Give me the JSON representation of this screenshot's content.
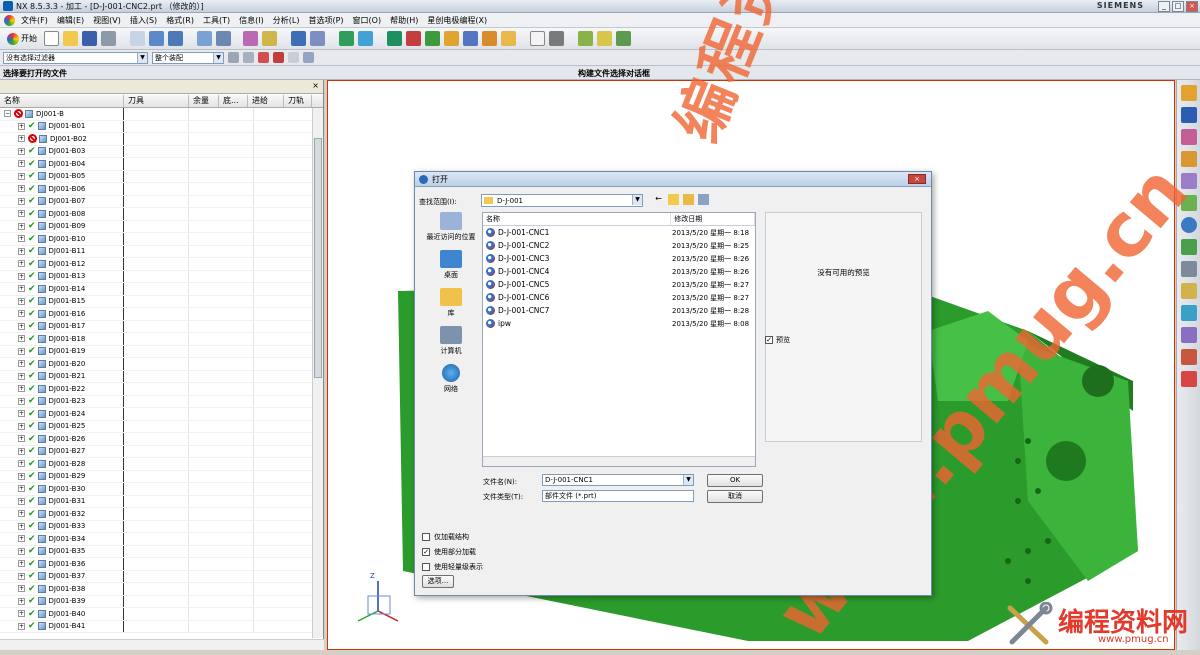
{
  "window": {
    "title": "NX 8.5.3.3 - 加工 - [D-J-001-CNC2.prt （修改的）]",
    "brand": "SIEMENS",
    "controls": [
      "_",
      "□",
      "×"
    ]
  },
  "menu": [
    "文件(F)",
    "编辑(E)",
    "视图(V)",
    "插入(S)",
    "格式(R)",
    "工具(T)",
    "信息(I)",
    "分析(L)",
    "首选项(P)",
    "窗口(O)",
    "帮助(H)",
    "星创电极编程(X)"
  ],
  "toolbar": {
    "start_label": "开始"
  },
  "filter_bar": {
    "filter_value": "没有选择过滤器",
    "assembly_value": "整个装配"
  },
  "prompt": {
    "left": "选择要打开的文件",
    "center": "构建文件选择对话框"
  },
  "navigator": {
    "columns": [
      "名称",
      "刀具",
      "余量",
      "底...",
      "进给",
      "刀轨"
    ],
    "root": "DJ001-B",
    "items": [
      "DJ001-B01",
      "DJ001-B02",
      "DJ001-B03",
      "DJ001-B04",
      "DJ001-B05",
      "DJ001-B06",
      "DJ001-B07",
      "DJ001-B08",
      "DJ001-B09",
      "DJ001-B10",
      "DJ001-B11",
      "DJ001-B12",
      "DJ001-B13",
      "DJ001-B14",
      "DJ001-B15",
      "DJ001-B16",
      "DJ001-B17",
      "DJ001-B18",
      "DJ001-B19",
      "DJ001-B20",
      "DJ001-B21",
      "DJ001-B22",
      "DJ001-B23",
      "DJ001-B24",
      "DJ001-B25",
      "DJ001-B26",
      "DJ001-B27",
      "DJ001-B28",
      "DJ001-B29",
      "DJ001-B30",
      "DJ001-B31",
      "DJ001-B32",
      "DJ001-B33",
      "DJ001-B34",
      "DJ001-B35",
      "DJ001-B36",
      "DJ001-B37",
      "DJ001-B38",
      "DJ001-B39",
      "DJ001-B40",
      "DJ001-B41"
    ]
  },
  "dialog": {
    "title": "打开",
    "look_in_label": "查找范围(I):",
    "look_in_value": "D-J-001",
    "places": [
      "最近访问的位置",
      "桌面",
      "库",
      "计算机",
      "网络"
    ],
    "col_name": "名称",
    "col_date": "修改日期",
    "files": [
      {
        "name": "D-J-001-CNC1",
        "date": "2013/5/20 星期一 8:18"
      },
      {
        "name": "D-J-001-CNC2",
        "date": "2013/5/20 星期一 8:25"
      },
      {
        "name": "D-J-001-CNC3",
        "date": "2013/5/20 星期一 8:26"
      },
      {
        "name": "D-J-001-CNC4",
        "date": "2013/5/20 星期一 8:26"
      },
      {
        "name": "D-J-001-CNC5",
        "date": "2013/5/20 星期一 8:27"
      },
      {
        "name": "D-J-001-CNC6",
        "date": "2013/5/20 星期一 8:27"
      },
      {
        "name": "D-J-001-CNC7",
        "date": "2013/5/20 星期一 8:28"
      },
      {
        "name": "ipw",
        "date": "2013/5/20 星期一 8:08"
      }
    ],
    "preview_msg": "没有可用的预览",
    "preview_label": "预览",
    "filename_label": "文件名(N):",
    "filename_value": "D-J-001-CNC1",
    "filetype_label": "文件类型(T):",
    "filetype_value": "部件文件 (*.prt)",
    "ok": "OK",
    "cancel": "取消",
    "opt_structure": "仅加载结构",
    "opt_partial": "使用部分加载",
    "opt_lightweight": "使用轻量级表示",
    "options_btn": "选项..."
  },
  "watermark": {
    "chinese": "编程资料网",
    "url": "www.pmug.cn",
    "corner_cn": "编程资料网",
    "corner_url": "www.pmug.cn"
  },
  "colors": {
    "model_green": "#2fa52f",
    "accent_blue": "#2b68b4",
    "watermark": "#f06432"
  }
}
